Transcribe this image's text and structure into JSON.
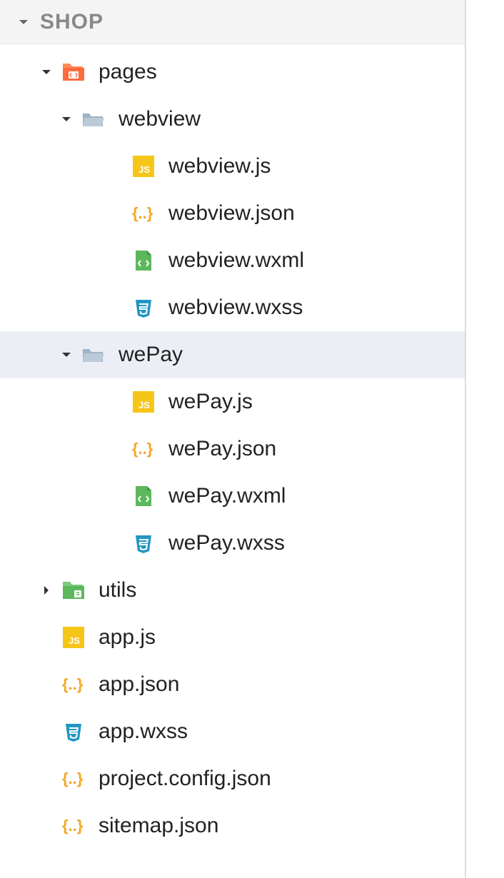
{
  "header": {
    "title": "SHOP"
  },
  "tree": {
    "pages": {
      "label": "pages",
      "expanded": true,
      "children": {
        "webview": {
          "label": "webview",
          "expanded": true,
          "files": [
            {
              "name": "webview.js",
              "type": "js"
            },
            {
              "name": "webview.json",
              "type": "json"
            },
            {
              "name": "webview.wxml",
              "type": "wxml"
            },
            {
              "name": "webview.wxss",
              "type": "wxss"
            }
          ]
        },
        "wePay": {
          "label": "wePay",
          "expanded": true,
          "selected": true,
          "files": [
            {
              "name": "wePay.js",
              "type": "js"
            },
            {
              "name": "wePay.json",
              "type": "json"
            },
            {
              "name": "wePay.wxml",
              "type": "wxml"
            },
            {
              "name": "wePay.wxss",
              "type": "wxss"
            }
          ]
        }
      }
    },
    "utils": {
      "label": "utils",
      "expanded": false
    },
    "root_files": [
      {
        "name": "app.js",
        "type": "js"
      },
      {
        "name": "app.json",
        "type": "json"
      },
      {
        "name": "app.wxss",
        "type": "wxss"
      },
      {
        "name": "project.config.json",
        "type": "json"
      },
      {
        "name": "sitemap.json",
        "type": "json"
      }
    ]
  }
}
